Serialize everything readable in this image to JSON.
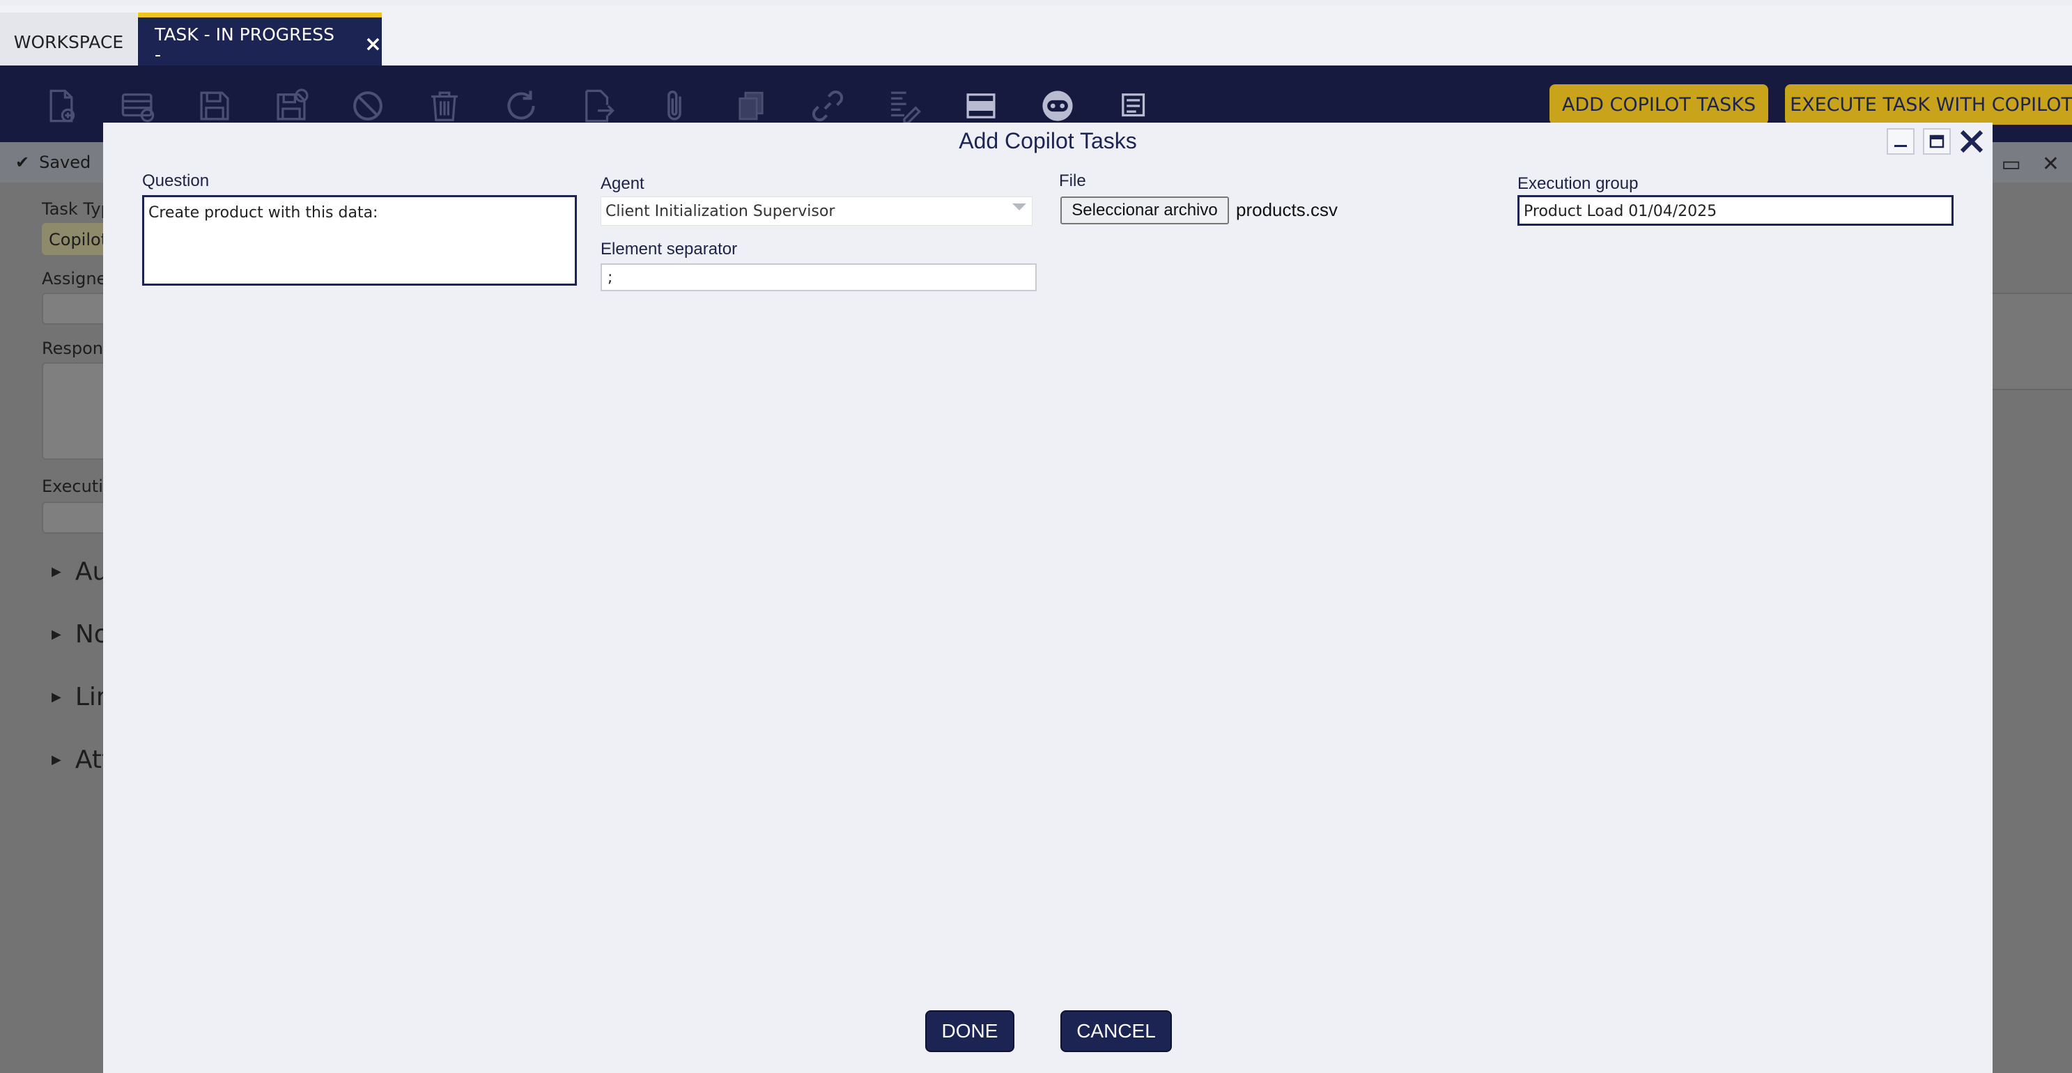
{
  "tabs": {
    "workspace": "WORKSPACE",
    "active": "TASK - IN PROGRESS -",
    "close_glyph": "×"
  },
  "toolbar": {
    "icons": [
      "new-document-icon",
      "new-record-icon",
      "save-icon",
      "save-and-close-icon",
      "cancel-icon",
      "delete-icon",
      "refresh-icon",
      "export-icon",
      "attach-icon",
      "copy-icon",
      "link-icon",
      "tools-icon",
      "grid-view-icon",
      "copilot-icon",
      "form-view-icon"
    ],
    "add_copilot_tasks": "ADD COPILOT TASKS",
    "execute_task_with_copilot": "EXECUTE TASK WITH COPILOT",
    "accent_color": "#c9a31a"
  },
  "background_form": {
    "status": "Saved",
    "task_type_label": "Task Typ",
    "task_type_value": "Copilot",
    "assignee_label": "Assigne",
    "response_label": "Respons",
    "execution_label": "Executio",
    "sections": [
      "Au",
      "No",
      "Lin",
      "Att"
    ]
  },
  "modal": {
    "title": "Add Copilot Tasks",
    "question": {
      "label": "Question",
      "value": "Create product with this data:"
    },
    "agent": {
      "label": "Agent",
      "value": "Client Initialization Supervisor"
    },
    "element_separator": {
      "label": "Element separator",
      "value": ";"
    },
    "file": {
      "label": "File",
      "button": "Seleccionar archivo",
      "filename": "products.csv"
    },
    "execution_group": {
      "label": "Execution group",
      "value": "Product Load 01/04/2025"
    },
    "done": "DONE",
    "cancel": "CANCEL"
  },
  "colors": {
    "primary": "#1c2454",
    "toolbar_bg": "#161a3e",
    "tab_accent": "#f0c419"
  }
}
